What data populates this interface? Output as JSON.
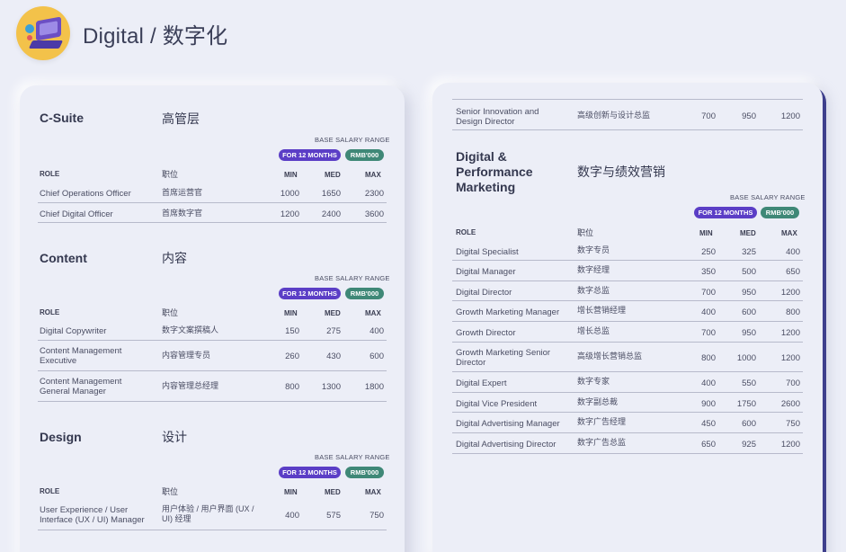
{
  "page": {
    "title": "Digital / 数字化"
  },
  "labels": {
    "base_salary_range": "BASE SALARY RANGE",
    "months": "FOR 12 MONTHS",
    "currency": "RMB'000",
    "role": "ROLE",
    "role_zh": "职位",
    "min": "MIN",
    "med": "MED",
    "max": "MAX"
  },
  "left_sections": [
    {
      "title": "C-Suite",
      "title_zh": "高管层",
      "rows": [
        {
          "role": "Chief Operations Officer",
          "role_zh": "首席运营官",
          "min": "1000",
          "med": "1650",
          "max": "2300"
        },
        {
          "role": "Chief Digital Officer",
          "role_zh": "首席数字官",
          "min": "1200",
          "med": "2400",
          "max": "3600"
        }
      ]
    },
    {
      "title": "Content",
      "title_zh": "内容",
      "rows": [
        {
          "role": "Digital Copywriter",
          "role_zh": "数字文案撰稿人",
          "min": "150",
          "med": "275",
          "max": "400"
        },
        {
          "role": "Content Management Executive",
          "role_zh": "内容管理专员",
          "min": "260",
          "med": "430",
          "max": "600"
        },
        {
          "role": "Content Management General Manager",
          "role_zh": "内容管理总经理",
          "min": "800",
          "med": "1300",
          "max": "1800"
        }
      ]
    },
    {
      "title": "Design",
      "title_zh": "设计",
      "rows": [
        {
          "role": "User Experience / User Interface (UX / UI) Manager",
          "role_zh": "用户体验 / 用户界面 (UX / UI) 经理",
          "min": "400",
          "med": "575",
          "max": "750"
        }
      ]
    }
  ],
  "right_top_row": {
    "role": "Senior Innovation and Design Director",
    "role_zh": "高级创新与设计总监",
    "min": "700",
    "med": "950",
    "max": "1200"
  },
  "right_section": {
    "title": "Digital & Performance Marketing",
    "title_zh": "数字与绩效营销",
    "rows": [
      {
        "role": "Digital Specialist",
        "role_zh": "数字专员",
        "min": "250",
        "med": "325",
        "max": "400"
      },
      {
        "role": "Digital Manager",
        "role_zh": "数字经理",
        "min": "350",
        "med": "500",
        "max": "650"
      },
      {
        "role": "Digital Director",
        "role_zh": "数字总监",
        "min": "700",
        "med": "950",
        "max": "1200"
      },
      {
        "role": "Growth Marketing Manager",
        "role_zh": "增长营销经理",
        "min": "400",
        "med": "600",
        "max": "800"
      },
      {
        "role": "Growth Director",
        "role_zh": "增长总监",
        "min": "700",
        "med": "950",
        "max": "1200"
      },
      {
        "role": "Growth Marketing Senior Director",
        "role_zh": "高级增长营销总监",
        "min": "800",
        "med": "1000",
        "max": "1200"
      },
      {
        "role": "Digital Expert",
        "role_zh": "数字专家",
        "min": "400",
        "med": "550",
        "max": "700"
      },
      {
        "role": "Digital Vice President",
        "role_zh": "数字副总裁",
        "min": "900",
        "med": "1750",
        "max": "2600"
      },
      {
        "role": "Digital Advertising Manager",
        "role_zh": "数字广告经理",
        "min": "450",
        "med": "600",
        "max": "750"
      },
      {
        "role": "Digital Advertising Director",
        "role_zh": "数字广告总监",
        "min": "650",
        "med": "925",
        "max": "1200"
      }
    ]
  }
}
